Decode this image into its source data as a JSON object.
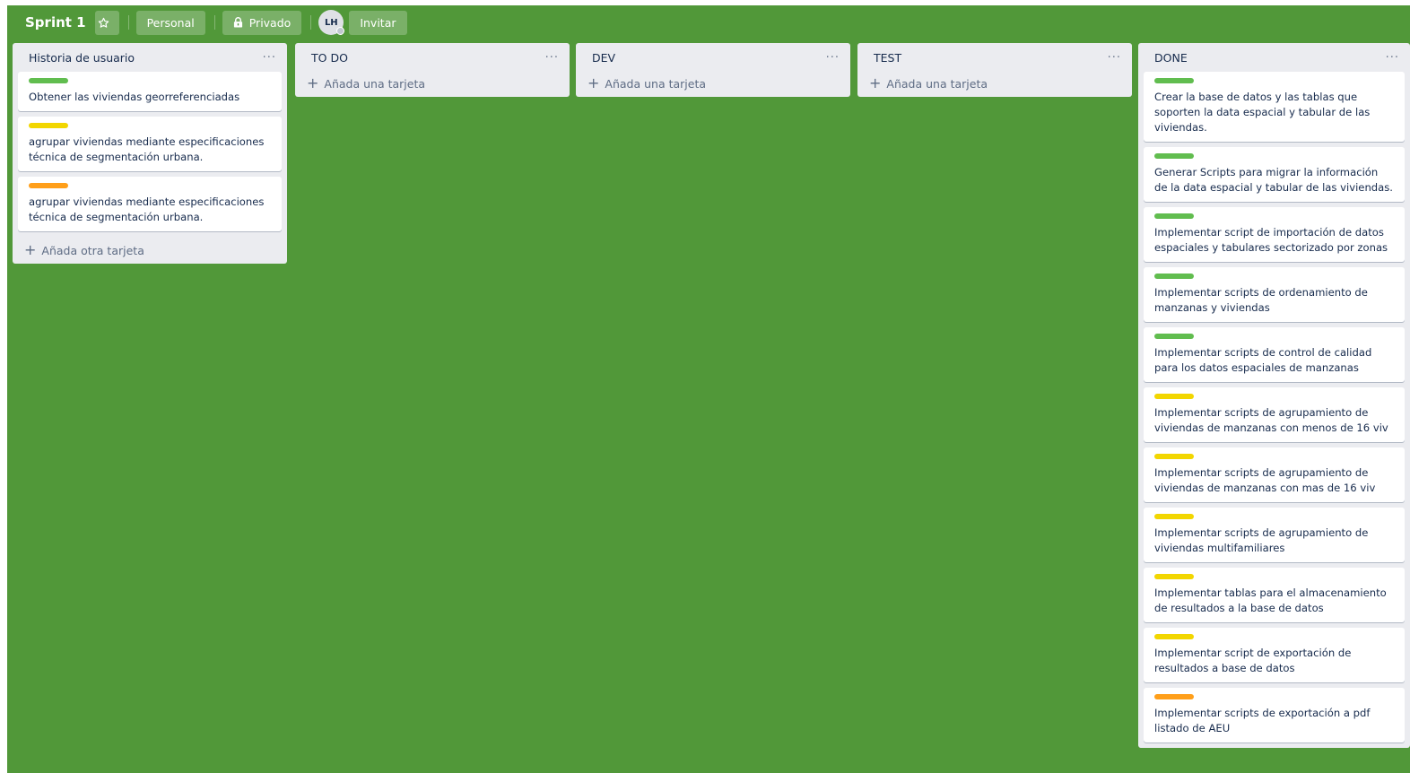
{
  "board": {
    "title": "Sprint 1",
    "star_icon": "star-icon",
    "team_label": "Personal",
    "visibility_label": "Privado",
    "lock_icon": "lock-icon",
    "avatar_initials": "LH",
    "invite_label": "Invitar"
  },
  "colors": {
    "board_bg": "#519839",
    "green": "#61bd4f",
    "yellow": "#f2d600",
    "orange": "#ff9f1a"
  },
  "lists": [
    {
      "title": "Historia de usuario",
      "menu": "···",
      "cards": [
        {
          "label": "green",
          "text": "Obtener las viviendas georreferenciadas"
        },
        {
          "label": "yellow",
          "text": "agrupar viviendas mediante especificaciones técnica de segmentación urbana."
        },
        {
          "label": "orange",
          "text": "agrupar viviendas mediante especificaciones técnica de segmentación urbana."
        }
      ],
      "add_label": "Añada otra tarjeta"
    },
    {
      "title": "TO DO",
      "menu": "···",
      "cards": [],
      "add_label": "Añada una tarjeta"
    },
    {
      "title": "DEV",
      "menu": "···",
      "cards": [],
      "add_label": "Añada una tarjeta"
    },
    {
      "title": "TEST",
      "menu": "···",
      "cards": [],
      "add_label": "Añada una tarjeta"
    },
    {
      "title": "DONE",
      "menu": "···",
      "cards": [
        {
          "label": "green",
          "text": "Crear la base de datos y las tablas que soporten la data espacial y tabular de las viviendas."
        },
        {
          "label": "green",
          "text": "Generar Scripts para migrar la información de la data espacial y tabular de las viviendas."
        },
        {
          "label": "green",
          "text": "Implementar script de importación de datos espaciales y tabulares sectorizado por zonas"
        },
        {
          "label": "green",
          "text": "Implementar scripts de ordenamiento de manzanas y viviendas"
        },
        {
          "label": "green",
          "text": "Implementar scripts de control de calidad para los datos espaciales de manzanas"
        },
        {
          "label": "yellow",
          "text": "Implementar scripts de agrupamiento de viviendas de manzanas con menos de 16 viv"
        },
        {
          "label": "yellow",
          "text": "Implementar scripts de agrupamiento de viviendas de manzanas con mas de 16 viv"
        },
        {
          "label": "yellow",
          "text": "Implementar scripts de agrupamiento de viviendas multifamiliares"
        },
        {
          "label": "yellow",
          "text": "Implementar tablas para el almacenamiento de resultados a la base de datos"
        },
        {
          "label": "yellow",
          "text": "Implementar script de exportación de resultados a base de datos"
        },
        {
          "label": "orange",
          "text": "Implementar scripts de exportación a pdf listado de AEU"
        }
      ],
      "add_label": ""
    }
  ]
}
